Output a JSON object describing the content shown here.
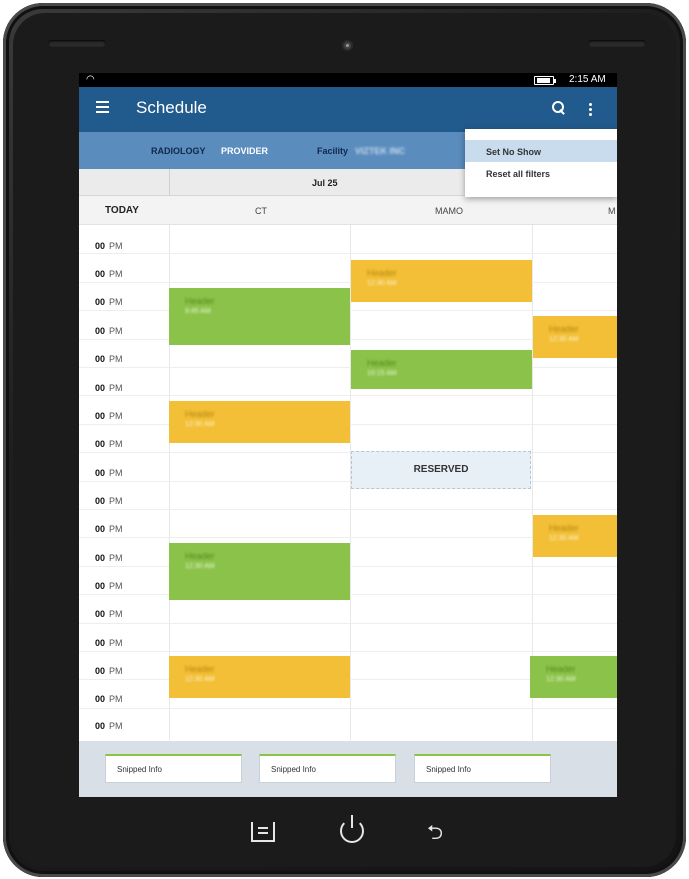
{
  "status_bar": {
    "time": "2:15 AM",
    "wifi_icon": "wifi-icon",
    "battery_icon": "battery-icon"
  },
  "app_bar": {
    "title": "Schedule",
    "menu_icon": "hamburger-menu-icon",
    "search_icon": "search-icon",
    "more_icon": "more-vert-icon"
  },
  "filters": {
    "modality": "RADIOLOGY",
    "provider": "PROVIDER",
    "facility_label": "Facility",
    "facility_value": "VIZTEK INC"
  },
  "date": "Jul 25",
  "columns": {
    "today": "TODAY",
    "names": [
      "CT",
      "MAMO",
      "M"
    ]
  },
  "time_slots": [
    {
      "num": "00",
      "ampm": "PM"
    },
    {
      "num": "00",
      "ampm": "PM"
    },
    {
      "num": "00",
      "ampm": "PM"
    },
    {
      "num": "00",
      "ampm": "PM"
    },
    {
      "num": "00",
      "ampm": "PM"
    },
    {
      "num": "00",
      "ampm": "PM"
    },
    {
      "num": "00",
      "ampm": "PM"
    },
    {
      "num": "00",
      "ampm": "PM"
    },
    {
      "num": "00",
      "ampm": "PM"
    },
    {
      "num": "00",
      "ampm": "PM"
    },
    {
      "num": "00",
      "ampm": "PM"
    },
    {
      "num": "00",
      "ampm": "PM"
    },
    {
      "num": "00",
      "ampm": "PM"
    },
    {
      "num": "00",
      "ampm": "PM"
    },
    {
      "num": "00",
      "ampm": "PM"
    },
    {
      "num": "00",
      "ampm": "PM"
    },
    {
      "num": "00",
      "ampm": "PM"
    },
    {
      "num": "00",
      "ampm": "PM"
    }
  ],
  "events": [
    {
      "header": "Header",
      "time": "9:45 AM",
      "color": "#8bc34a"
    },
    {
      "header": "Header",
      "time": "12:30 AM",
      "color": "#f2bf36"
    },
    {
      "header": "Header",
      "time": "12:30 AM",
      "color": "#8bc34a"
    },
    {
      "header": "Header",
      "time": "12:30 AM",
      "color": "#f2bf36"
    },
    {
      "header": "Header",
      "time": "12:30 AM",
      "color": "#f2bf36"
    },
    {
      "header": "Header",
      "time": "10:15 AM",
      "color": "#8bc34a"
    },
    {
      "header": "Header",
      "time": "12:30 AM",
      "color": "#f2bf36"
    },
    {
      "header": "Header",
      "time": "12:30 AM",
      "color": "#f2bf36"
    },
    {
      "header": "Header",
      "time": "12:30 AM",
      "color": "#8bc34a"
    }
  ],
  "reserved": "RESERVED",
  "dropdown": {
    "items": [
      "Set No Show",
      "Reset all filters"
    ]
  },
  "footer": {
    "snippets": [
      "Snipped Info",
      "Snipped Info",
      "Snipped Info"
    ]
  },
  "hardware_buttons": {
    "menu": "menu-button-icon",
    "power": "power-icon",
    "back": "back-arrow-icon"
  },
  "colors": {
    "app_bar": "#215a8c",
    "filter_bar": "#5a8cbd",
    "green": "#8bc34a",
    "yellow": "#f2bf36"
  }
}
